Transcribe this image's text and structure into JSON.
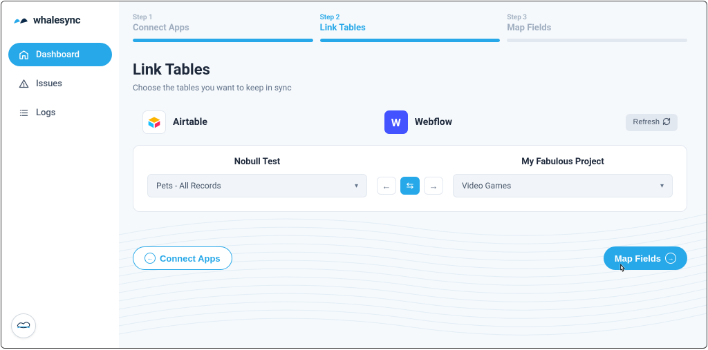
{
  "brand": {
    "name": "whalesync"
  },
  "nav": {
    "dashboard": "Dashboard",
    "issues": "Issues",
    "logs": "Logs"
  },
  "stepper": {
    "step1": {
      "num": "Step 1",
      "title": "Connect Apps"
    },
    "step2": {
      "num": "Step 2",
      "title": "Link Tables"
    },
    "step3": {
      "num": "Step 3",
      "title": "Map Fields"
    }
  },
  "page": {
    "title": "Link Tables",
    "subtitle": "Choose the tables you want to keep in sync"
  },
  "apps": {
    "left": {
      "name": "Airtable"
    },
    "right": {
      "name": "Webflow",
      "glyph": "W"
    }
  },
  "refresh": "Refresh",
  "card": {
    "leftHeading": "Nobull Test",
    "rightHeading": "My Fabulous Project",
    "leftSelect": "Pets - All Records",
    "rightSelect": "Video Games"
  },
  "footer": {
    "back": "Connect Apps",
    "next": "Map Fields"
  }
}
